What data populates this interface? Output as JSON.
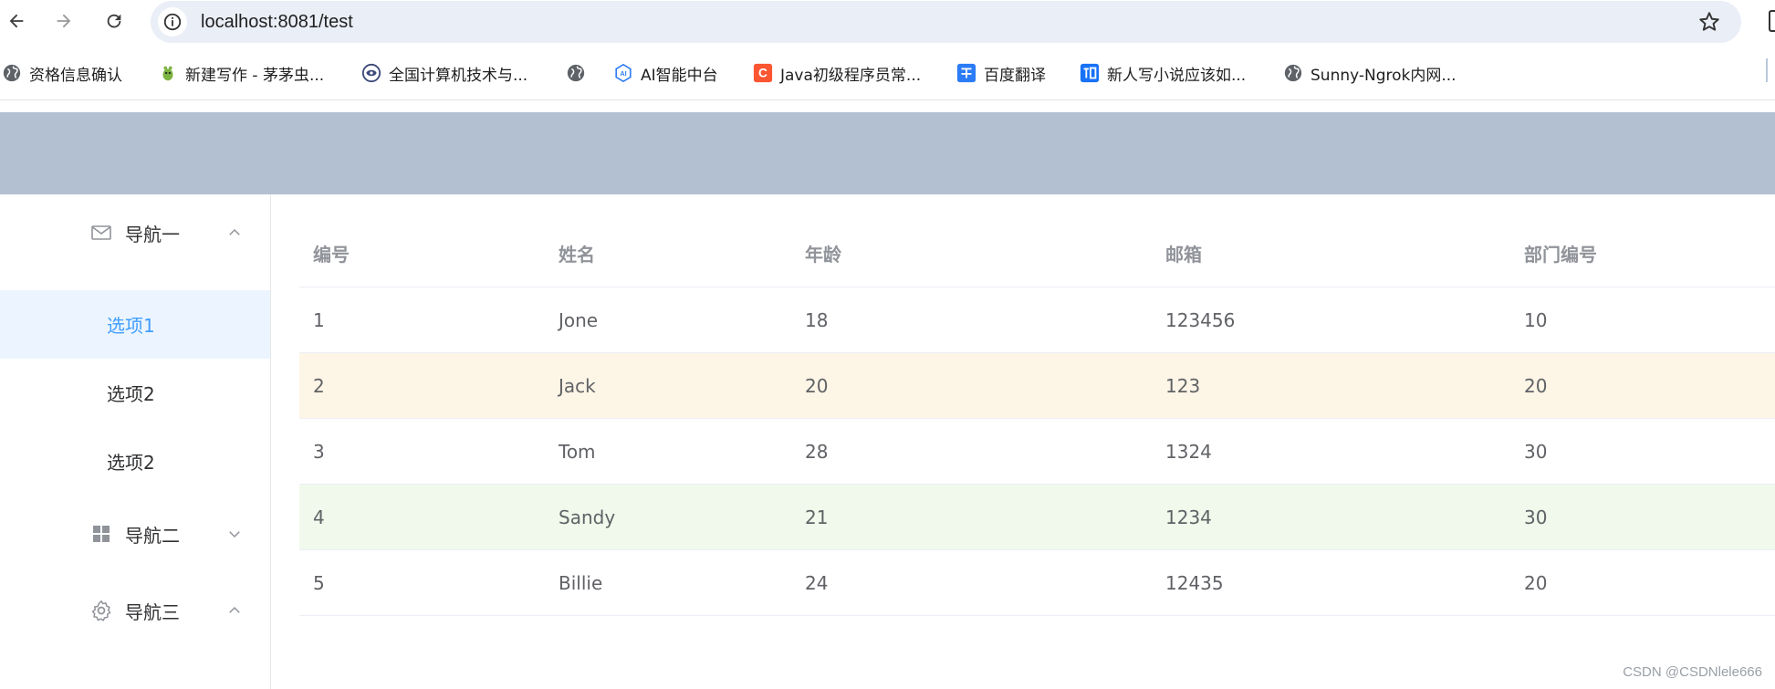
{
  "browser": {
    "url": "localhost:8081/test",
    "bookmarks": [
      {
        "label": "资格信息确认",
        "icon": "globe-icon"
      },
      {
        "label": "新建写作 - 茅茅虫...",
        "icon": "bug-icon"
      },
      {
        "label": "全国计算机技术与...",
        "icon": "eye-logo-icon"
      },
      {
        "label": "",
        "icon": "globe-icon"
      },
      {
        "label": "AI智能中台",
        "icon": "ai-icon"
      },
      {
        "label": "Java初级程序员常...",
        "icon": "csdn-icon"
      },
      {
        "label": "百度翻译",
        "icon": "translate-icon"
      },
      {
        "label": "新人写小说应该如...",
        "icon": "zhihu-icon"
      },
      {
        "label": "Sunny-Ngrok内网...",
        "icon": "globe-icon"
      }
    ]
  },
  "sidebar": {
    "nav1": {
      "label": "导航一",
      "icon": "mail-icon",
      "expanded": true
    },
    "items": [
      {
        "label": "选项1",
        "active": true
      },
      {
        "label": "选项2",
        "active": false
      },
      {
        "label": "选项2",
        "active": false
      }
    ],
    "nav2": {
      "label": "导航二",
      "icon": "grid-icon",
      "expanded": false
    },
    "nav3": {
      "label": "导航三",
      "icon": "gear-icon",
      "expanded": true
    }
  },
  "table": {
    "headers": [
      "编号",
      "姓名",
      "年龄",
      "邮箱",
      "部门编号"
    ],
    "rows": [
      {
        "cells": [
          "1",
          "Jone",
          "18",
          "123456",
          "10"
        ],
        "bg": "#ffffff"
      },
      {
        "cells": [
          "2",
          "Jack",
          "20",
          "123",
          "20"
        ],
        "bg": "#fdf5e6"
      },
      {
        "cells": [
          "3",
          "Tom",
          "28",
          "1324",
          "30"
        ],
        "bg": "#ffffff"
      },
      {
        "cells": [
          "4",
          "Sandy",
          "21",
          "1234",
          "30"
        ],
        "bg": "#f0f9eb"
      },
      {
        "cells": [
          "5",
          "Billie",
          "24",
          "12435",
          "20"
        ],
        "bg": "#ffffff"
      }
    ]
  },
  "colors": {
    "header_bg": "#b3c0d1",
    "active_bg": "#ecf5ff",
    "active_text": "#409eff"
  },
  "watermark": "CSDN @CSDNlele666"
}
